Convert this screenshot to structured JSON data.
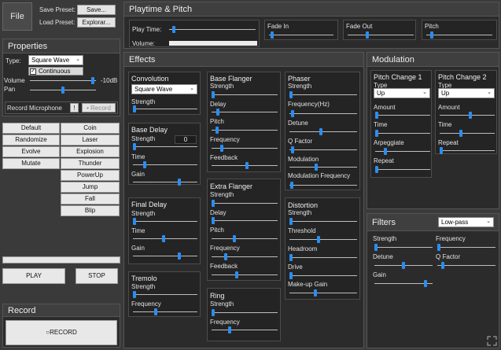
{
  "file": {
    "label": "File"
  },
  "preset": {
    "save_label": "Save Preset:",
    "save_btn": "Save...",
    "load_label": "Load Preset:",
    "load_btn": "Explorar..."
  },
  "properties": {
    "title": "Properties",
    "type_label": "Type:",
    "type_value": "Square Wave",
    "continuous_label": "Continuous",
    "continuous_checked": true,
    "volume_label": "Volume",
    "volume_value": "-10dB",
    "volume_level": 0.95,
    "pan_label": "Pan",
    "pan_level": 0.5,
    "record_mic_label": "Record Microphone",
    "mic_btn": "!",
    "record_btn": "• Record"
  },
  "presets_left": [
    "Default",
    "Randomize",
    "Evolve",
    "Mutate"
  ],
  "presets_right": [
    "Coin",
    "Laser",
    "Explosion",
    "Thunder",
    "PowerUp",
    "Jump",
    "Fall",
    "Blip"
  ],
  "transport": {
    "play": "PLAY",
    "stop": "STOP"
  },
  "record": {
    "title": "Record",
    "button": "○RECORD"
  },
  "playtime": {
    "title": "Playtime & Pitch",
    "play_time_label": "Play Time:",
    "play_time_level": 0.05,
    "volume_label": "Volume:",
    "fade_in_label": "Fade In",
    "fade_in_level": 0.05,
    "fade_out_label": "Fade Out",
    "fade_out_level": 0.3,
    "pitch_label": "Pitch",
    "pitch_level": 0.08
  },
  "effects": {
    "title": "Effects",
    "convolution": {
      "title": "Convolution",
      "preset": "Square Wave",
      "strength_label": "Strength",
      "strength_level": 0.02
    },
    "base_delay": {
      "title": "Base Delay",
      "strength_label": "Strength",
      "strength_value": "0",
      "strength_level": 0.02,
      "time_label": "Time",
      "time_level": 0.18,
      "gain_label": "Gain",
      "gain_level": 0.72
    },
    "final_delay": {
      "title": "Final Delay",
      "strength_label": "Strength",
      "strength_level": 0.02,
      "time_label": "Time",
      "time_level": 0.47,
      "gain_label": "Gain",
      "gain_level": 0.72
    },
    "tremolo": {
      "title": "Tremolo",
      "strength_label": "Strength",
      "strength_level": 0.02,
      "frequency_label": "Frequency",
      "frequency_level": 0.35
    },
    "base_flanger": {
      "title": "Base Flanger",
      "strength_label": "Strength",
      "strength_level": 0.02,
      "delay_label": "Delay",
      "delay_level": 0.1,
      "pitch_label": "Pitch",
      "pitch_level": 0.08,
      "frequency_label": "Frequency",
      "frequency_level": 0.15,
      "feedback_label": "Feedback",
      "feedback_level": 0.54
    },
    "extra_flanger": {
      "title": "Extra Flanger",
      "strength_label": "Strength",
      "strength_level": 0.02,
      "delay_label": "Delay",
      "delay_level": 0.02,
      "pitch_label": "Pitch",
      "pitch_level": 0.35,
      "frequency_label": "Frequency",
      "frequency_level": 0.21,
      "feedback_label": "Feedback",
      "feedback_level": 0.38
    },
    "ring": {
      "title": "Ring",
      "strength_label": "Strength",
      "strength_level": 0.02,
      "frequency_label": "Frequency",
      "frequency_level": 0.27
    },
    "phaser": {
      "title": "Phaser",
      "strength_label": "Strength",
      "strength_level": 0.02,
      "frequency_label": "Frequency(Hz)",
      "frequency_level": 0.05,
      "detune_label": "Detune",
      "detune_level": 0.47,
      "q_label": "Q Factor",
      "q_level": 0.05,
      "modulation_label": "Modulation",
      "modulation_level": 0.4,
      "mod_freq_label": "Modulation Frequency",
      "mod_freq_level": 0.03
    },
    "distortion": {
      "title": "Distortion",
      "strength_label": "Strength",
      "strength_level": 0.02,
      "threshold_label": "Threshold",
      "threshold_level": 0.43,
      "headroom_label": "Headroom",
      "headroom_level": 0.02,
      "drive_label": "Drive",
      "drive_level": 0.02,
      "makeup_label": "Make-up Gain",
      "makeup_level": 0.38
    }
  },
  "modulation": {
    "title": "Modulation",
    "pc1": {
      "title": "Pitch Change 1",
      "type_label": "Type",
      "type_value": "Up",
      "amount_label": "Amount",
      "amount_level": 0.03,
      "time_label": "Time",
      "time_level": 0.03,
      "arpeggiate_label": "Arpeggiate",
      "arpeggiate_level": 0.18,
      "repeat_label": "Repeat",
      "repeat_level": 0.03
    },
    "pc2": {
      "title": "Pitch Change 2",
      "type_label": "Type",
      "type_value": "Up",
      "amount_label": "Amount",
      "amount_level": 0.55,
      "time_label": "Time",
      "time_level": 0.38,
      "repeat_label": "Repeat",
      "repeat_level": 0.03
    }
  },
  "filters": {
    "title": "Filters",
    "type_value": "Low-pass",
    "strength_label": "Strength",
    "strength_level": 0.02,
    "frequency_label": "Frequency",
    "frequency_level": 0.02,
    "detune_label": "Detune",
    "detune_level": 0.5,
    "q_label": "Q Factor",
    "q_level": 0.1,
    "gain_label": "Gain",
    "gain_level": 0.88
  },
  "icons": {
    "dropdown": "chevron-down-icon",
    "resize": "resize-icon"
  },
  "colors": {
    "accent": "#2b8df0",
    "background": "#3a3a3a",
    "panel": "#2b2b2b"
  }
}
